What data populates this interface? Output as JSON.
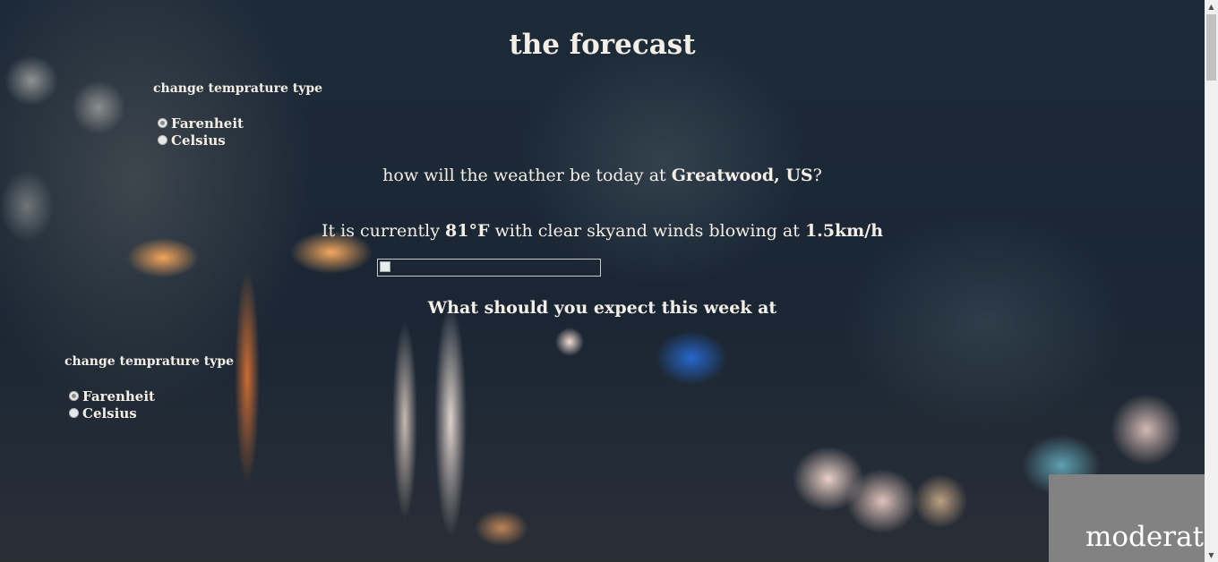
{
  "page": {
    "title": "the forecast"
  },
  "unit_form_top": {
    "heading": "change temprature type",
    "options": [
      {
        "label": "Farenheit",
        "checked": true
      },
      {
        "label": "Celsius",
        "checked": false
      }
    ]
  },
  "unit_form_bottom": {
    "heading": "change temprature type",
    "options": [
      {
        "label": "Farenheit",
        "checked": true
      },
      {
        "label": "Celsius",
        "checked": false
      }
    ]
  },
  "today": {
    "question_prefix": "how will the weather be today at ",
    "location": "Greatwood, US",
    "question_suffix": "?",
    "current_prefix": "It is currently ",
    "temperature": "81°F",
    "current_middle": " with clear skyand winds blowing at ",
    "wind_speed": "1.5km/h"
  },
  "week": {
    "heading": "What should you expect this week at"
  },
  "card": {
    "text": "moderate"
  },
  "icons": {
    "weather_image": "broken-image-icon",
    "scroll_up": "arrow-up-icon",
    "scroll_down": "arrow-down-icon"
  },
  "colors": {
    "text": "#f4efe6",
    "card_background": "#828282",
    "background": "#1c2938"
  }
}
